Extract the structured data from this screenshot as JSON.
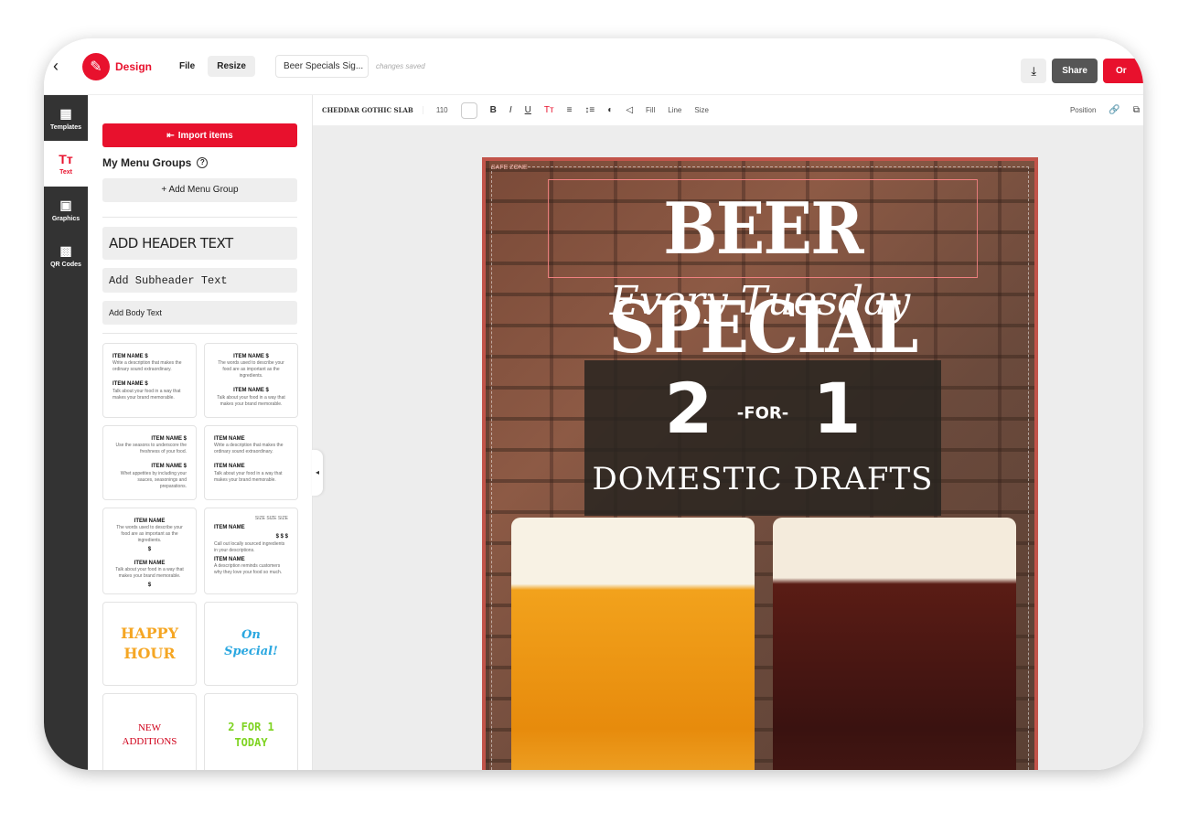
{
  "topbar": {
    "brand": "Design",
    "file": "File",
    "resize": "Resize",
    "doc_name": "Beer Specials Sig...",
    "status": "changes saved",
    "share": "Share",
    "order": "Or"
  },
  "rail": [
    {
      "label": "Templates",
      "icon": "template-icon"
    },
    {
      "label": "Text",
      "icon": "text-icon"
    },
    {
      "label": "Graphics",
      "icon": "image-icon"
    },
    {
      "label": "QR Codes",
      "icon": "qr-icon"
    }
  ],
  "panel": {
    "import": "Import items",
    "my_groups": "My Menu Groups",
    "add_group": "+ Add Menu Group",
    "header": "ADD HEADER TEXT",
    "subheader": "Add Subheader Text",
    "body": "Add Body Text",
    "cards": {
      "item": "ITEM NAME $",
      "item_plain": "ITEM NAME",
      "d1": "Write a description that makes the ordinary sound extraordinary.",
      "d2": "Talk about your food in a way that makes your brand memorable.",
      "d3": "The words used to describe your food are as important as the ingredients.",
      "d4": "Use the seasons to underscore the freshness of your food.",
      "d5": "Whet appetites by including your sauces, seasonings and preparations.",
      "d6": "Call out locally sourced ingredients in your descriptions.",
      "d7": "A description reminds customers why they love your food so much.",
      "size": "SIZE  SIZE  SIZE",
      "prices": "$   $   $",
      "dollar": "$"
    },
    "styles": [
      {
        "text": "HAPPY HOUR",
        "color": "#f5a623"
      },
      {
        "text": "On Special!",
        "color": "#2aa7e0"
      },
      {
        "text": "NEW ADDITIONS",
        "color": "#d0021b"
      },
      {
        "text": "2 FOR 1 TODAY",
        "color": "#7ed321"
      }
    ]
  },
  "toolbar": {
    "font": "CHEDDAR GOTHIC SLAB",
    "size": "110",
    "bold": "B",
    "italic": "I",
    "underline": "U",
    "case": "Tт",
    "fill": "Fill",
    "line": "Line",
    "sizebtn": "Size",
    "position": "Position"
  },
  "poster": {
    "safe_zone": "SAFE ZONE",
    "title": "BEER SPECIAL",
    "subtitle": "Every Tuesday",
    "two": "2",
    "for": "-FOR-",
    "one": "1",
    "drafts": "DOMESTIC DRAFTS"
  },
  "colors": {
    "accent": "#e8112d",
    "rail": "#333333"
  }
}
